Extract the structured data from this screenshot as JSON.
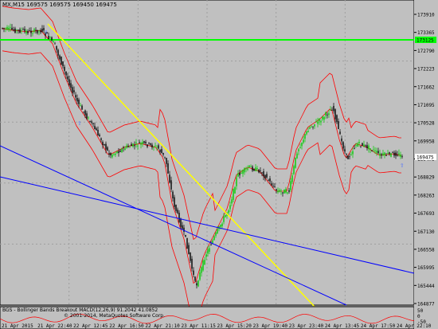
{
  "window": {
    "header_text": "MX,M15  169575 169575 169450 169475",
    "indicator_text": "BGS - Bollinger Bands Breakout",
    "indicator_values": "MACD(12,26,9) 91.2042 41.0852",
    "copyright": "© 2001-2014, MetaQuotes Software Corp."
  },
  "price_axis": {
    "labels": [
      "173910",
      "173365",
      "172790",
      "172223",
      "171662",
      "171095",
      "170528",
      "169958",
      "169475",
      "168829",
      "168263",
      "167693",
      "167130",
      "166558",
      "165995",
      "165444",
      "164877"
    ],
    "current_price": "169475",
    "hline_price": "173125"
  },
  "time_axis": {
    "labels": [
      "21 Apr 2015",
      "21 Apr 22:40",
      "22 Apr 12:45",
      "22 Apr 16:50",
      "22 Apr 21:10",
      "23 Apr 11:15",
      "23 Apr 15:20",
      "23 Apr 19:40",
      "23 Apr 23:40",
      "24 Apr 13:45",
      "24 Apr 17:50",
      "24 Apr 22:10"
    ]
  },
  "indicator_axis": {
    "labels": [
      "50",
      "0",
      "-50"
    ]
  },
  "colors": {
    "background": "#c0c0c0",
    "grid": "#9e9e9e",
    "bull_candle": "#00cc00",
    "bear_candle": "#000000",
    "bands": "#ff0000",
    "hline": "#00ff00",
    "trendline_yellow": "#ffff00",
    "trendline_blue": "#0000ff",
    "price_tag": "#ffffff"
  },
  "icons": [
    "up-arrow-signal-icon"
  ]
}
